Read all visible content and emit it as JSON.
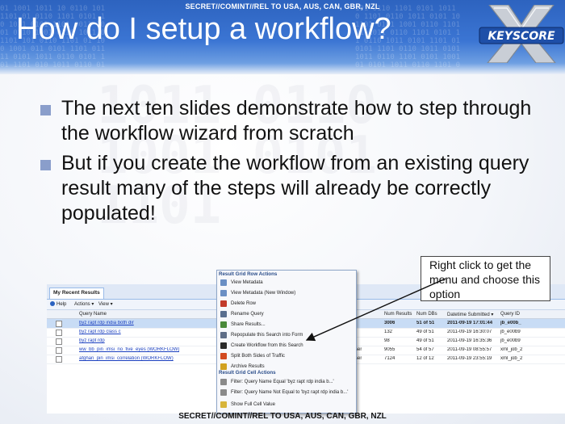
{
  "classification": {
    "top": "SECRET//COMINT//REL TO USA, AUS, CAN, GBR, NZL",
    "bottom": "SECRET//COMINT//REL TO USA, AUS, CAN, GBR, NZL"
  },
  "slide": {
    "title": "How do I setup a workflow?",
    "logo_text": "KEYSCORE",
    "bullets": [
      "The next ten slides demonstrate how to step through the workflow wizard from scratch",
      "But if you create the workflow from an existing query result many of the steps will already be correctly populated!"
    ],
    "callout": "Right click to get the menu and choose this option"
  },
  "colors": {
    "banner": "#3b75d3",
    "bullet_square": "#8a9ecb",
    "link": "#1a3fbf",
    "selected_row": "#c8dcf5"
  },
  "app": {
    "tab": "My Recent Results",
    "toolbar": {
      "help": "Help",
      "actions": "Actions ▾",
      "view": "View ▾"
    },
    "columns": [
      "Query Name",
      "Num Results",
      "Num DBs",
      "Datetime Submitted ▾",
      "Query ID"
    ],
    "rows": [
      {
        "name": "byz rapt rdp india both dir",
        "results": "3006",
        "dbs": "51 of 51",
        "datetime": "2011-09-19 17:01:44",
        "id": "jb_e00b_"
      },
      {
        "name": "byz rapt rdp class c",
        "results": "132",
        "dbs": "49 of 51",
        "datetime": "2011-09-19 16:30:07",
        "id": "jb_e00b9"
      },
      {
        "name": "byz rapt rdp",
        "results": "98",
        "dbs": "49 of 51",
        "datetime": "2011-09-19 16:35:36",
        "id": "jb_e00b9"
      },
      {
        "name": "ww_bb_pin_imsi_no_five_eyes (WORKFLOW)",
        "results": "9055",
        "dbs": "54 of 57",
        "datetime": "2011-09-19 08:55:57",
        "id": "xml_job_2"
      },
      {
        "name": "afghan_pin_imsi_correlation (WORKFLOW)",
        "results": "7124",
        "dbs": "12 of 12",
        "datetime": "2011-09-19 23:55:19",
        "id": "xml_job_2"
      }
    ],
    "row_tails": [
      "ser",
      "ser"
    ]
  },
  "context_menu": {
    "section1": "Result Grid Row Actions",
    "items1": [
      {
        "label": "View Metadata",
        "icon": "document-icon",
        "color": "#6a8fc4"
      },
      {
        "label": "View Metadata (New Window)",
        "icon": "window-icon",
        "color": "#6a8fc4"
      },
      {
        "label": "Delete Row",
        "icon": "delete-icon",
        "color": "#c23b2b"
      },
      {
        "label": "Rename Query",
        "icon": "rename-icon",
        "color": "#5a6f8f"
      },
      {
        "label": "Share Results...",
        "icon": "share-icon",
        "color": "#4a8a3a"
      },
      {
        "label": "Repopulate this Search into Form",
        "icon": "magnifier-icon",
        "color": "#5e6d87"
      },
      {
        "label": "Create Workflow from this Search",
        "icon": "workflow-icon",
        "color": "#2a2a2a"
      },
      {
        "label": "Split Both Sides of Traffic",
        "icon": "split-icon",
        "color": "#d24a1f"
      },
      {
        "label": "Archive Results",
        "icon": "archive-icon",
        "color": "#d2a21f"
      }
    ],
    "section2": "Result Grid Cell Actions",
    "items2": [
      {
        "label": "Filter: Query Name Equal 'byz rapt rdp india b...'",
        "icon": "filter-icon",
        "color": "#8a8a8a"
      },
      {
        "label": "Filter: Query Name Not Equal to 'byz rapt rdp india b...'",
        "icon": "filter-not-icon",
        "color": "#8a8a8a"
      }
    ],
    "item_last": {
      "label": "Show Full Cell Value",
      "icon": "cell-icon",
      "color": "#d8b53a"
    }
  }
}
